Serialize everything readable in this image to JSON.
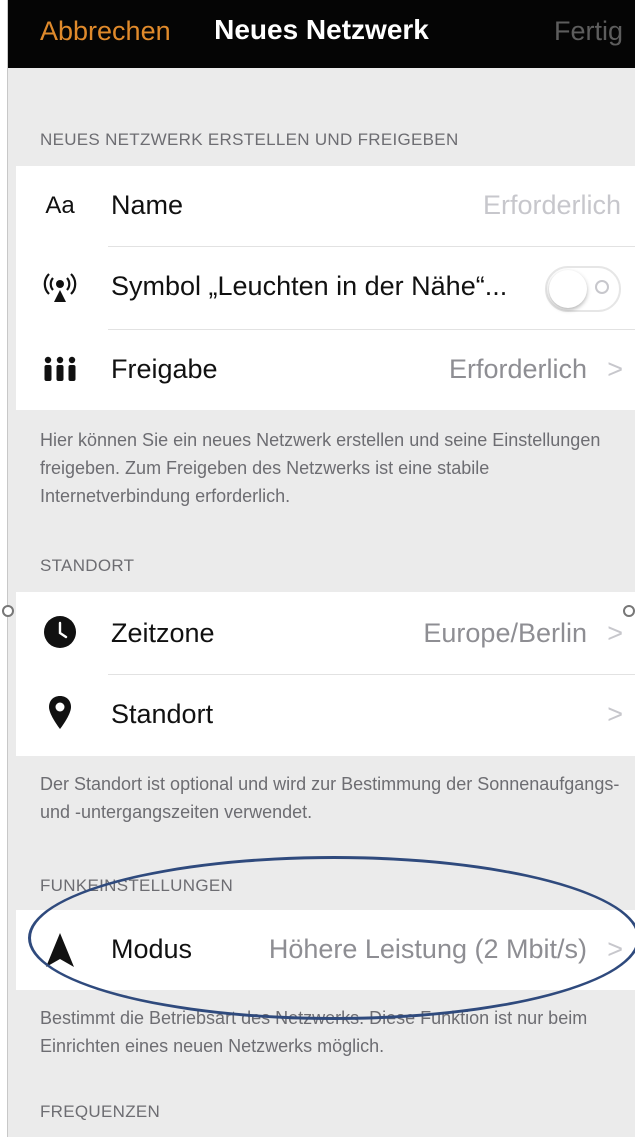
{
  "navbar": {
    "cancel": "Abbrechen",
    "title": "Neues Netzwerk",
    "done": "Fertig"
  },
  "section_create": {
    "header": "NEUES NETZWERK ERSTELLEN UND FREIGEBEN",
    "rows": [
      {
        "icon_text": "Aa",
        "label": "Name",
        "value": "Erforderlich"
      },
      {
        "icon": "beacon-icon",
        "label": "Symbol „Leuchten in der Nähe“...",
        "toggle_on": false
      },
      {
        "icon": "people-icon",
        "label": "Freigabe",
        "value": "Erforderlich",
        "chevron": ">"
      }
    ],
    "footer": "Hier können Sie ein neues Netzwerk erstellen und seine Einstellungen freigeben. Zum Freigeben des Netzwerks ist eine stabile Internetverbindung erforderlich."
  },
  "section_location": {
    "header": "STANDORT",
    "rows": [
      {
        "icon": "clock-icon",
        "label": "Zeitzone",
        "value": "Europe/Berlin",
        "chevron": ">"
      },
      {
        "icon": "location-pin-icon",
        "label": "Standort",
        "value": "",
        "chevron": ">"
      }
    ],
    "footer": "Der Standort ist optional und wird zur Bestimmung der Sonnenaufgangs- und -untergangszeiten verwendet."
  },
  "section_radio": {
    "header": "FUNKEINSTELLUNGEN",
    "rows": [
      {
        "icon": "navigation-arrow-icon",
        "label": "Modus",
        "value": "Höhere Leistung (2 Mbit/s)",
        "chevron": ">"
      }
    ],
    "footer": "Bestimmt die Betriebsart des Netzwerks. Diese Funktion ist nur beim Einrichten eines neuen Netzwerks möglich."
  },
  "section_frequencies": {
    "header": "FREQUENZEN"
  },
  "colors": {
    "accent": "#e08a2b",
    "navbar_bg": "#050505",
    "annotation": "#2f4a7d"
  }
}
